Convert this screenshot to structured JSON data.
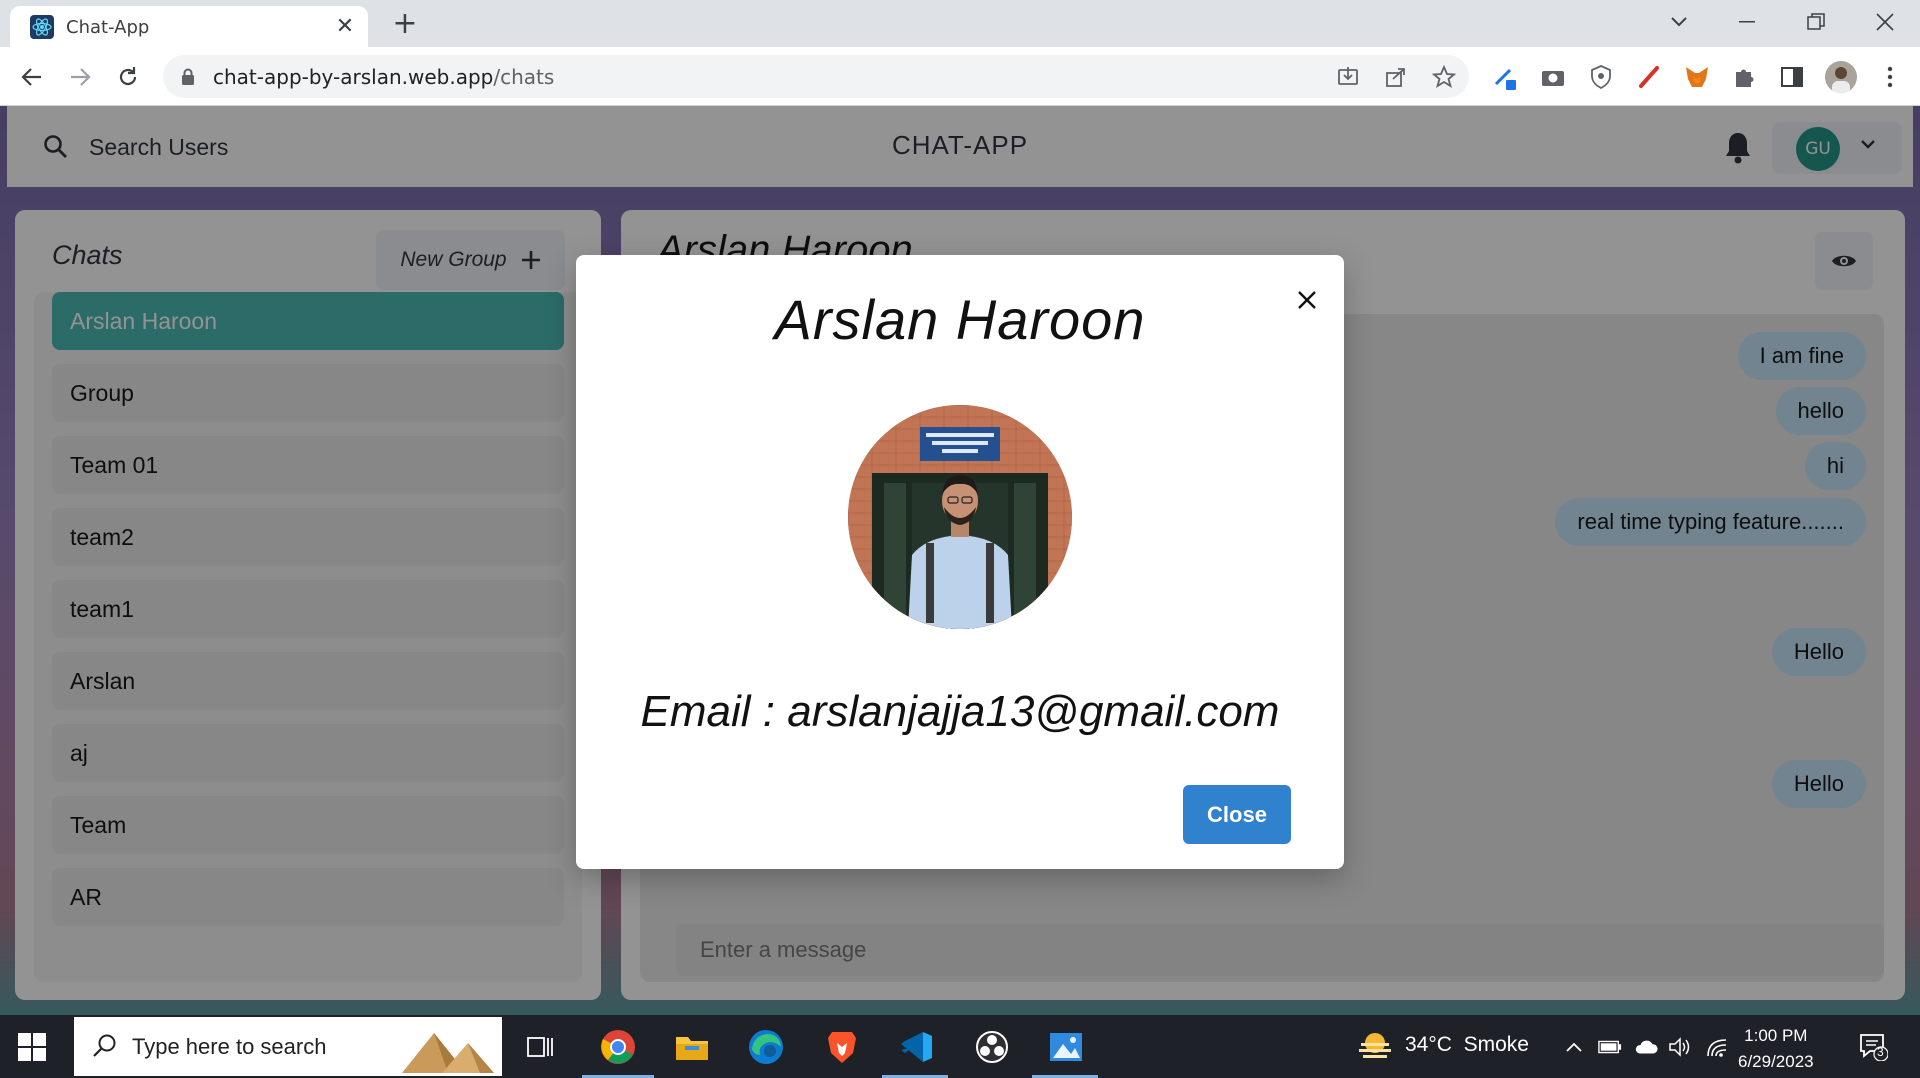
{
  "browser": {
    "tab_title": "Chat-App",
    "url_host": "chat-app-by-arslan.web.app",
    "url_path": "/chats"
  },
  "app": {
    "search_label": "Search Users",
    "title": "CHAT-APP",
    "user_initials": "GU"
  },
  "chats": {
    "heading": "Chats",
    "new_group_label": "New Group",
    "items": [
      "Arslan Haroon",
      "Group",
      "Team 01",
      "team2",
      "team1",
      "Arslan",
      "aj",
      "Team",
      "AR"
    ]
  },
  "chat_box": {
    "heading": "Arslan Haroon",
    "messages": [
      "I am fine",
      "hello",
      "hi",
      "real time typing feature.......",
      "Hello",
      "Hello"
    ],
    "input_placeholder": "Enter a message"
  },
  "modal": {
    "name": "Arslan Haroon",
    "email_line": "Email : arslanjajja13@gmail.com",
    "close_label": "Close"
  },
  "taskbar": {
    "search_placeholder": "Type here to search",
    "weather": "34°C  Smoke",
    "time": "1:00 PM",
    "date": "6/29/2023",
    "notification_count": "3"
  },
  "colors": {
    "accent_teal": "#38b2ac",
    "avatar_green": "#0f8a7b",
    "modal_button_blue": "#3182ce",
    "bubble_blue": "#bee3f8"
  }
}
